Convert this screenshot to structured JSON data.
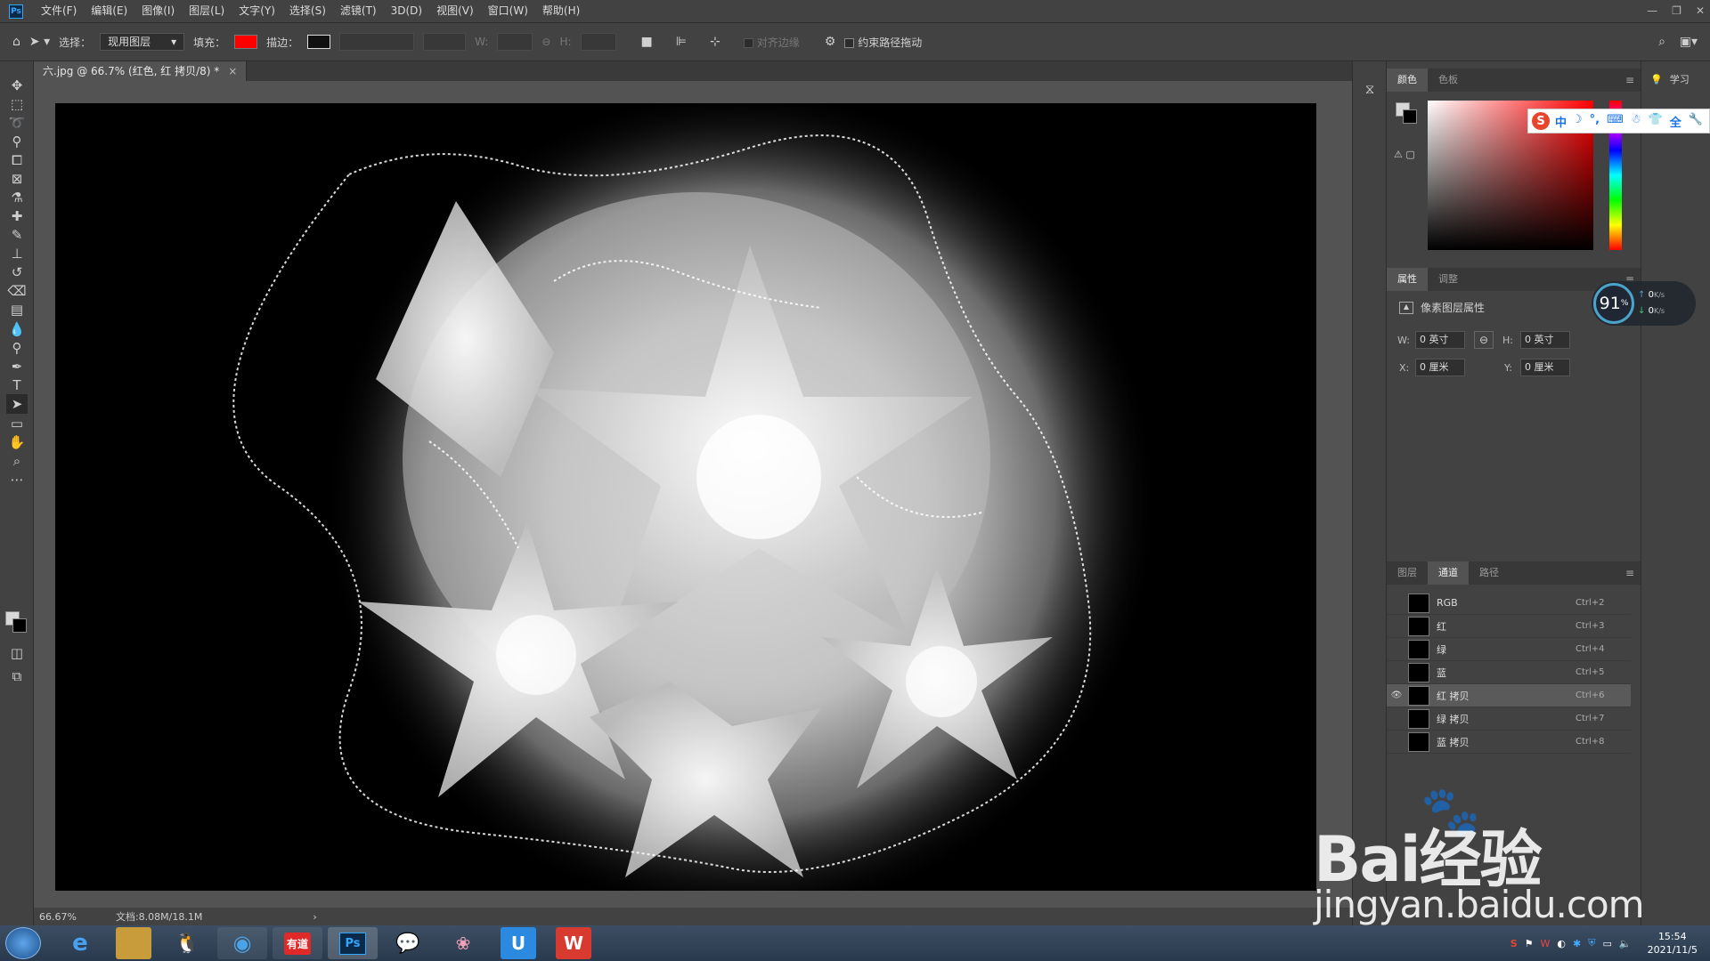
{
  "app": {
    "logo": "Ps"
  },
  "menu": [
    "文件(F)",
    "编辑(E)",
    "图像(I)",
    "图层(L)",
    "文字(Y)",
    "选择(S)",
    "滤镜(T)",
    "3D(D)",
    "视图(V)",
    "窗口(W)",
    "帮助(H)"
  ],
  "window_controls": {
    "minimize": "—",
    "restore": "❐",
    "close": "✕"
  },
  "options": {
    "select_label": "选择：",
    "select_value": "现用图层",
    "fill_label": "填充：",
    "fill_color": "#ff0000",
    "stroke_label": "描边：",
    "w_label": "W:",
    "h_label": "H:",
    "align_edges": "对齐边缘",
    "constrain_path": "约束路径拖动"
  },
  "document": {
    "tab_title": "六.jpg @ 66.7% (红色, 红 拷贝/8) *",
    "close": "×"
  },
  "status": {
    "zoom": "66.67%",
    "doc_size": "文档:8.08M/18.1M",
    "arrow": "›"
  },
  "tools": [
    "move-tool",
    "marquee-tool",
    "lasso-tool",
    "quick-select-tool",
    "crop-tool",
    "frame-tool",
    "eyedropper-tool",
    "healing-tool",
    "brush-tool",
    "stamp-tool",
    "history-brush-tool",
    "eraser-tool",
    "gradient-tool",
    "blur-tool",
    "dodge-tool",
    "pen-tool",
    "type-tool",
    "path-select-tool",
    "rectangle-tool",
    "hand-tool",
    "zoom-tool",
    "more-tools"
  ],
  "color_panel": {
    "tabs": [
      "颜色",
      "色板"
    ],
    "active": "颜色"
  },
  "properties_panel": {
    "tabs": [
      "属性",
      "调整"
    ],
    "active": "属性",
    "title": "像素图层属性",
    "w_label": "W:",
    "w_value": "0 英寸",
    "h_label": "H:",
    "h_value": "0 英寸",
    "x_label": "X:",
    "x_value": "0 厘米",
    "y_label": "Y:",
    "y_value": "0 厘米"
  },
  "layers_panel": {
    "tabs": [
      "图层",
      "通道",
      "路径"
    ],
    "active": "通道",
    "channels": [
      {
        "name": "RGB",
        "shortcut": "Ctrl+2",
        "visible": false
      },
      {
        "name": "红",
        "shortcut": "Ctrl+3",
        "visible": false
      },
      {
        "name": "绿",
        "shortcut": "Ctrl+4",
        "visible": false
      },
      {
        "name": "蓝",
        "shortcut": "Ctrl+5",
        "visible": false
      },
      {
        "name": "红 拷贝",
        "shortcut": "Ctrl+6",
        "visible": true
      },
      {
        "name": "绿 拷贝",
        "shortcut": "Ctrl+7",
        "visible": false
      },
      {
        "name": "蓝 拷贝",
        "shortcut": "Ctrl+8",
        "visible": false
      }
    ]
  },
  "learn": {
    "label": "学习"
  },
  "ime_bar": {
    "logo": "S",
    "mode": "中",
    "items": [
      "☽",
      "°,",
      "⌨",
      "☃",
      "👕",
      "全",
      "🔧"
    ]
  },
  "net_monitor": {
    "percent": "91",
    "unit": "%",
    "up": "0",
    "down": "0",
    "speed_unit": "K/s"
  },
  "watermark": {
    "brand": "Bai经验",
    "url": "jingyan.baidu.com"
  },
  "taskbar": {
    "apps": [
      "ie",
      "explorer",
      "qq",
      "browser",
      "youdao",
      "photoshop",
      "wechat",
      "app-pink",
      "app-shield",
      "wps"
    ],
    "youdao_label": "有道",
    "ps_label": "Ps",
    "time": "15:54",
    "date": "2021/11/5"
  }
}
